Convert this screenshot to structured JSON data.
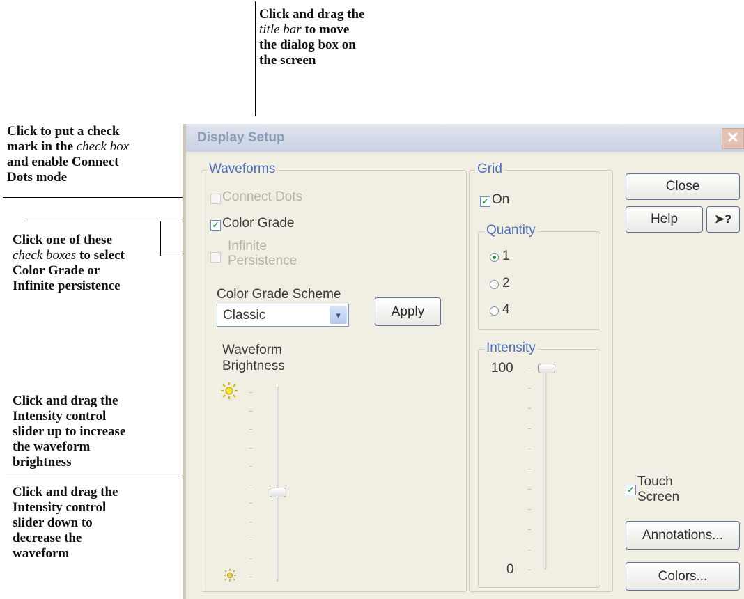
{
  "callouts": {
    "title_bar": {
      "l1": "Click and drag the",
      "l2_em": "title bar",
      "l2_rest": " to move",
      "l3": "the dialog box on",
      "l4": "the screen"
    },
    "connect_dots": {
      "l1": "Click to put a check",
      "l2": "mark in the ",
      "l2_em": "check box",
      "l3": "and enable Connect",
      "l4": "Dots mode"
    },
    "check_boxes": {
      "l1": "Click one of these",
      "l2_em": "check boxes",
      "l2_rest": " to select",
      "l3": "Color Grade or",
      "l4": "Infinite persistence"
    },
    "slider_up": {
      "l1": "Click and drag the",
      "l2": "Intensity control",
      "l3": "slider up to increase",
      "l4": "the waveform",
      "l5": "brightness"
    },
    "slider_down": {
      "l1": "Click and drag the",
      "l2": "Intensity control",
      "l3": "slider down to",
      "l4": "decrease the",
      "l5": "waveform"
    }
  },
  "dialog": {
    "title": "Display Setup",
    "close_glyph": "✕",
    "waveforms": {
      "label": "Waveforms",
      "connect_dots": {
        "label": "Connect Dots",
        "checked": false,
        "enabled": false
      },
      "color_grade": {
        "label": "Color Grade",
        "checked": true,
        "enabled": true
      },
      "infinite_persistence": {
        "label_l1": "Infinite",
        "label_l2": "Persistence",
        "checked": false,
        "enabled": false
      },
      "scheme_label": "Color Grade Scheme",
      "scheme_value": "Classic",
      "apply_label": "Apply",
      "brightness_label_l1": "Waveform",
      "brightness_label_l2": "Brightness",
      "brightness_level": 0.46
    },
    "grid": {
      "label": "Grid",
      "on_label": "On",
      "on_checked": true,
      "quantity": {
        "label": "Quantity",
        "options": [
          "1",
          "2",
          "4"
        ],
        "selected": "1"
      },
      "intensity": {
        "label": "Intensity",
        "max_label": "100",
        "min_label": "0",
        "value": 100
      }
    },
    "buttons": {
      "close": "Close",
      "help": "Help",
      "whatsthis": "?",
      "annotations": "Annotations...",
      "colors": "Colors..."
    },
    "touch_screen": {
      "label_l1": "Touch",
      "label_l2": "Screen",
      "checked": true
    }
  },
  "colors": {
    "group_label": "#4d6fb7",
    "title_bar": "#c9d2e3",
    "dialog_bg": "#f1efe3",
    "check_green": "#22a04a"
  }
}
